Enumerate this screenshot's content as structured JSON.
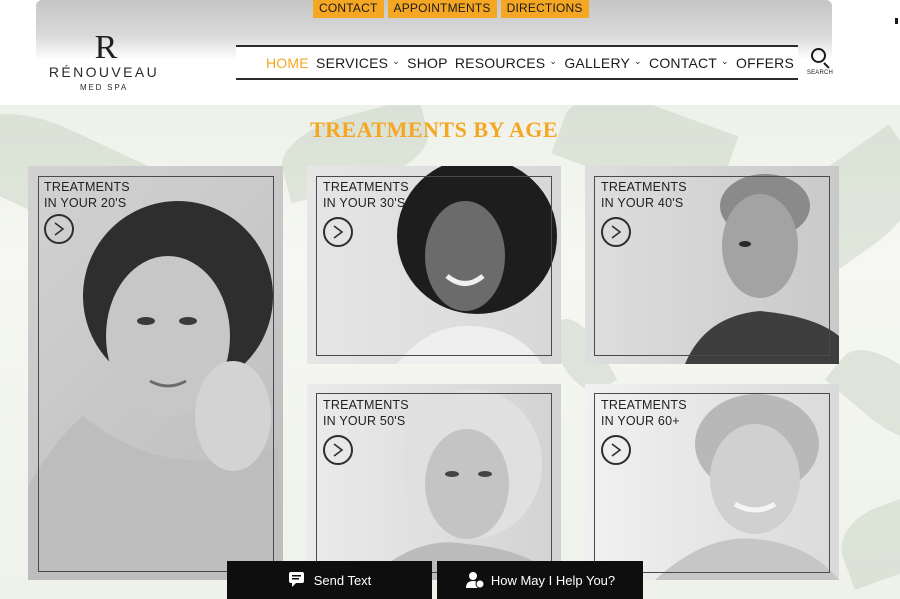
{
  "header": {
    "topbar": [
      "CONTACT",
      "APPOINTMENTS",
      "DIRECTIONS"
    ],
    "logo": {
      "mark": "R",
      "name": "RÉNOUVEAU",
      "sub": "MED SPA"
    },
    "nav": [
      {
        "label": "HOME",
        "active": true,
        "dropdown": false
      },
      {
        "label": "SERVICES",
        "active": false,
        "dropdown": true
      },
      {
        "label": "SHOP",
        "active": false,
        "dropdown": false
      },
      {
        "label": "RESOURCES",
        "active": false,
        "dropdown": true
      },
      {
        "label": "GALLERY",
        "active": false,
        "dropdown": true
      },
      {
        "label": "CONTACT",
        "active": false,
        "dropdown": true
      },
      {
        "label": "OFFERS",
        "active": false,
        "dropdown": false
      }
    ],
    "search_label": "SEARCH",
    "accent_color": "#f5a623"
  },
  "main": {
    "section_title": "TREATMENTS BY AGE",
    "cards": [
      {
        "line1": "TREATMENTS",
        "line2": "IN YOUR 20'S"
      },
      {
        "line1": "TREATMENTS",
        "line2": "IN YOUR 30'S"
      },
      {
        "line1": "TREATMENTS",
        "line2": "IN YOUR 40'S"
      },
      {
        "line1": "TREATMENTS",
        "line2": "IN YOUR 50'S"
      },
      {
        "line1": "TREATMENTS",
        "line2": "IN YOUR 60+"
      }
    ]
  },
  "chat": {
    "send_text": "Send Text",
    "help": "How May I Help You?"
  }
}
